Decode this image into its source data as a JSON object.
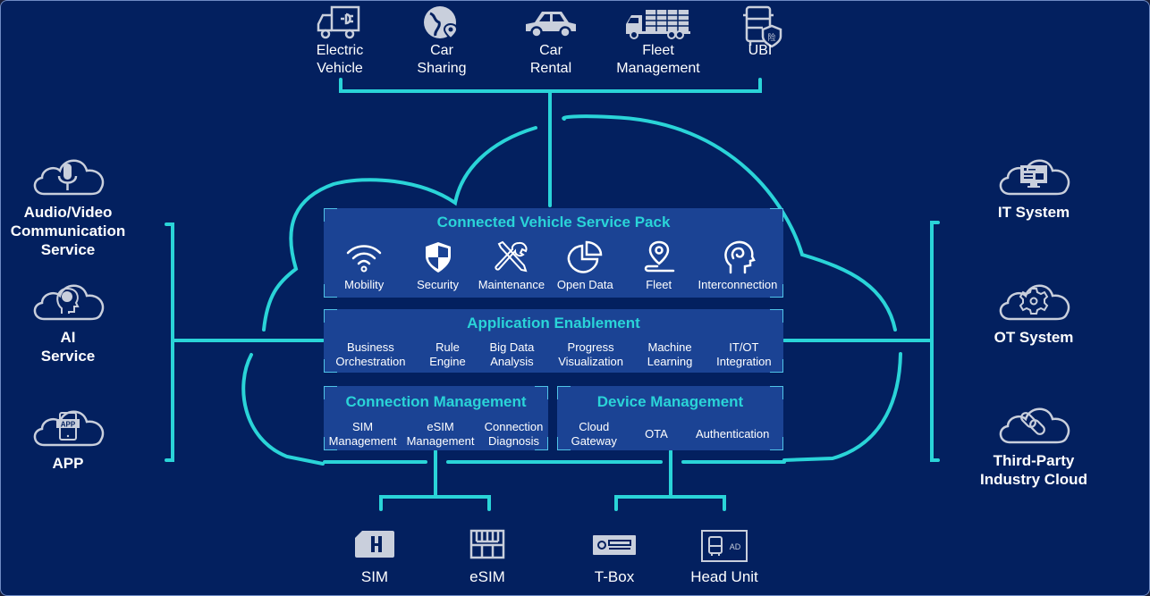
{
  "colors": {
    "background": "#03205f",
    "connector": "#2ad4d8",
    "panel": "#1b4394",
    "panel_title": "#2ad4d8",
    "icon": "#c9cfdc",
    "text": "#ffffff"
  },
  "top_scenarios": [
    {
      "icon": "electric-vehicle-icon",
      "line1": "Electric",
      "line2": "Vehicle"
    },
    {
      "icon": "globe-pin-icon",
      "line1": "Car",
      "line2": "Sharing"
    },
    {
      "icon": "car-icon",
      "line1": "Car",
      "line2": "Rental"
    },
    {
      "icon": "truck-icon",
      "line1": "Fleet",
      "line2": "Management"
    },
    {
      "icon": "bus-insurance-icon",
      "line1": "UBI",
      "line2": ""
    }
  ],
  "left_services": [
    {
      "icon": "cloud-microphone-icon",
      "lines": [
        "Audio/Video",
        "Communication",
        "Service"
      ]
    },
    {
      "icon": "cloud-ai-head-icon",
      "lines": [
        "AI",
        "Service"
      ]
    },
    {
      "icon": "cloud-app-icon",
      "lines": [
        "APP"
      ]
    }
  ],
  "right_systems": [
    {
      "icon": "cloud-monitor-icon",
      "lines": [
        "IT System"
      ]
    },
    {
      "icon": "cloud-gear-icon",
      "lines": [
        "OT System"
      ]
    },
    {
      "icon": "cloud-link-icon",
      "lines": [
        "Third-Party",
        "Industry Cloud"
      ]
    }
  ],
  "service_pack": {
    "title": "Connected Vehicle Service Pack",
    "items": [
      {
        "icon": "wifi-icon",
        "label": "Mobility"
      },
      {
        "icon": "shield-icon",
        "label": "Security"
      },
      {
        "icon": "tools-icon",
        "label": "Maintenance"
      },
      {
        "icon": "pie-chart-icon",
        "label": "Open Data"
      },
      {
        "icon": "location-pin-icon",
        "label": "Fleet"
      },
      {
        "icon": "head-icon",
        "label": "Interconnection"
      }
    ]
  },
  "app_enablement": {
    "title": "Application Enablement",
    "items": [
      {
        "line1": "Business",
        "line2": "Orchestration"
      },
      {
        "line1": "Rule",
        "line2": "Engine"
      },
      {
        "line1": "Big Data",
        "line2": "Analysis"
      },
      {
        "line1": "Progress",
        "line2": "Visualization"
      },
      {
        "line1": "Machine",
        "line2": "Learning"
      },
      {
        "line1": "IT/OT",
        "line2": "Integration"
      }
    ]
  },
  "connection_mgmt": {
    "title": "Connection Management",
    "items": [
      {
        "line1": "SIM",
        "line2": "Management"
      },
      {
        "line1": "eSIM",
        "line2": "Management"
      },
      {
        "line1": "Connection",
        "line2": "Diagnosis"
      }
    ]
  },
  "device_mgmt": {
    "title": "Device Management",
    "items": [
      {
        "line1": "Cloud",
        "line2": "Gateway"
      },
      {
        "line1": "OTA",
        "line2": ""
      },
      {
        "line1": "Authentication",
        "line2": ""
      }
    ]
  },
  "bottom_devices": [
    {
      "icon": "sim-card-icon",
      "label": "SIM"
    },
    {
      "icon": "esim-chip-icon",
      "label": "eSIM"
    },
    {
      "icon": "tbox-icon",
      "label": "T-Box"
    },
    {
      "icon": "head-unit-icon",
      "label": "Head Unit",
      "badge": "AD"
    }
  ]
}
